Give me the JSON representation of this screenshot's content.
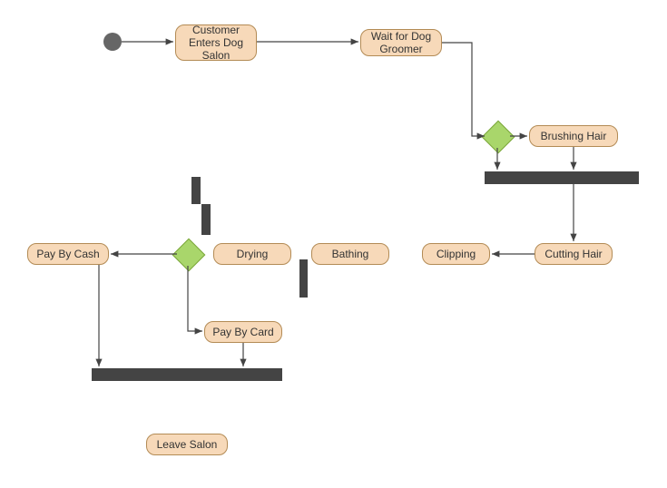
{
  "diagram": {
    "type": "uml-activity",
    "initial_node": true,
    "activities": {
      "enter": "Customer Enters Dog Salon",
      "wait": "Wait for Dog Groomer",
      "brushing": "Brushing Hair",
      "cutting": "Cutting Hair",
      "clipping": "Clipping",
      "bathing": "Bathing",
      "drying": "Drying",
      "paycash": "Pay By Cash",
      "paycard": "Pay By Card",
      "leave": "Leave Salon"
    },
    "decisions": 2,
    "fork_join_bars": 2
  }
}
